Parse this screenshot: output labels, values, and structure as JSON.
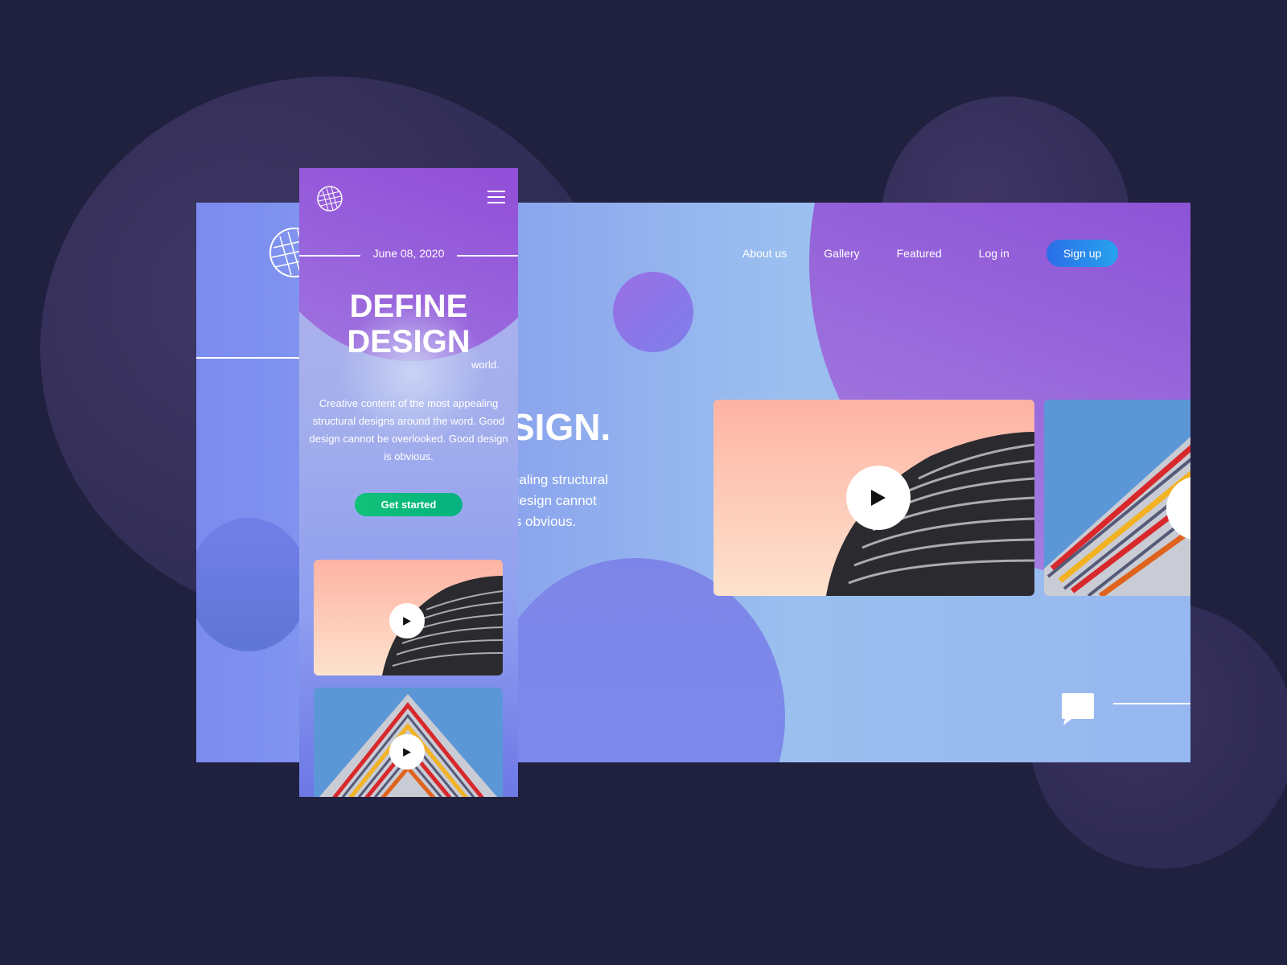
{
  "desktop": {
    "nav": [
      {
        "label": "About us"
      },
      {
        "label": "Gallery"
      },
      {
        "label": "Featured"
      },
      {
        "label": "Log in"
      }
    ],
    "signup_label": "Sign up",
    "headline_fragment": "SIGN.",
    "copy_lines": [
      "ealing structural",
      "design cannot",
      "is obvious."
    ]
  },
  "mobile": {
    "date": "June 08, 2020",
    "title_line1": "DEFINE",
    "title_line2": "DESIGN",
    "title_suffix": "world.",
    "description": "Creative content of the most appealing structural designs around the word. Good design cannot be overlooked. Good design is obvious.",
    "cta_label": "Get started"
  },
  "colors": {
    "page_bg": "#20203f",
    "accent_purple": "#7f34d0",
    "signup_blue": "#2b6ee8",
    "cta_green": "#10c177"
  },
  "icons": [
    "logo-icon",
    "hamburger-menu-icon",
    "play-icon",
    "chat-icon"
  ]
}
